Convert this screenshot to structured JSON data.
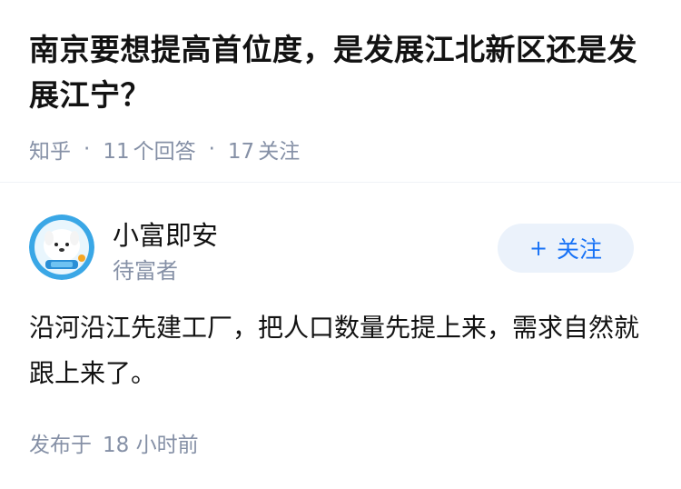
{
  "question": {
    "title": "南京要想提高首位度，是发展江北新区还是发展江宁？",
    "source": "知乎",
    "answers_count": "11",
    "answers_label": "个回答",
    "followers_count": "17",
    "followers_label": "关注"
  },
  "answer": {
    "author_name": "小富即安",
    "author_subtitle": "待富者",
    "follow_button_label": "关注",
    "body": "沿河沿江先建工厂，把人口数量先提上来，需求自然就跟上来了。",
    "published_label": "发布于",
    "published_time": "18 小时前"
  },
  "colors": {
    "accent": "#1772f6",
    "follow_bg": "#ebf2fb",
    "meta_text": "#8590a6",
    "avatar_bg": "#3aa7e6"
  }
}
